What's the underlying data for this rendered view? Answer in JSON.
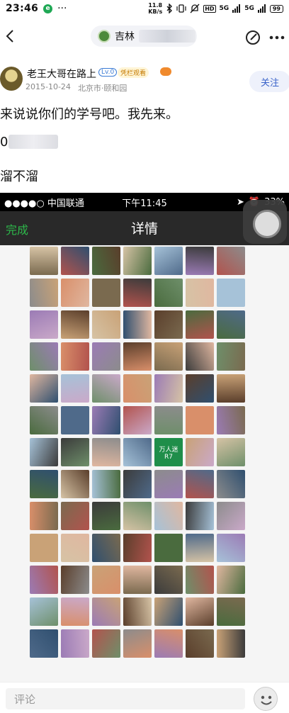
{
  "status_bar": {
    "time": "23:46",
    "notif_badge": "e",
    "more": "···",
    "netspeed_value": "11.8",
    "netspeed_unit": "KB/s",
    "hd": "HD",
    "signal1": "5G",
    "signal2": "5G",
    "battery": "99"
  },
  "header": {
    "group_name_visible": "吉林"
  },
  "author": {
    "name": "老王大哥在路上",
    "level": "Lv.0",
    "fan_badge": "凭栏观看",
    "date": "2015-10-24",
    "location": "北京市·颐和园",
    "follow_label": "关注"
  },
  "post": {
    "line1": "来说说你们的学号吧。我先来。",
    "line2_visible": "0",
    "line3": "溜不溜"
  },
  "embedded_screenshot": {
    "carrier": "●●●●○ 中国联通",
    "time": "下午11:45",
    "battery": "33%",
    "done_label": "完成",
    "title": "详情",
    "tile_texts": [
      "万人迷",
      "R7"
    ]
  },
  "comment_bar": {
    "placeholder": "评论"
  },
  "colors": {
    "accent": "#3a63c9",
    "wechat_green": "#2db84a"
  }
}
